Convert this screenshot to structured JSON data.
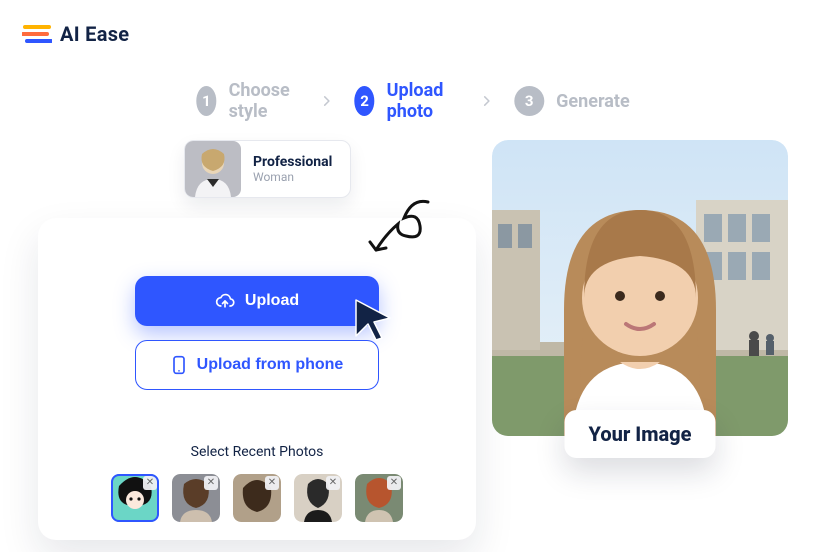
{
  "brand": {
    "name": "AI Ease"
  },
  "steps": [
    {
      "num": "1",
      "label": "Choose style",
      "active": false
    },
    {
      "num": "2",
      "label": "Upload photo",
      "active": true
    },
    {
      "num": "3",
      "label": "Generate",
      "active": false
    }
  ],
  "style_chip": {
    "title": "Professional",
    "subtitle": "Woman"
  },
  "upload": {
    "primary_label": "Upload",
    "secondary_label": "Upload from phone",
    "recent_label": "Select Recent Photos"
  },
  "recent_photos": [
    {
      "selected": true
    },
    {
      "selected": false
    },
    {
      "selected": false
    },
    {
      "selected": false
    },
    {
      "selected": false
    }
  ],
  "result": {
    "badge": "Your Image"
  },
  "colors": {
    "accent": "#2f56ff",
    "muted": "#b8bdc6",
    "text": "#122345"
  }
}
